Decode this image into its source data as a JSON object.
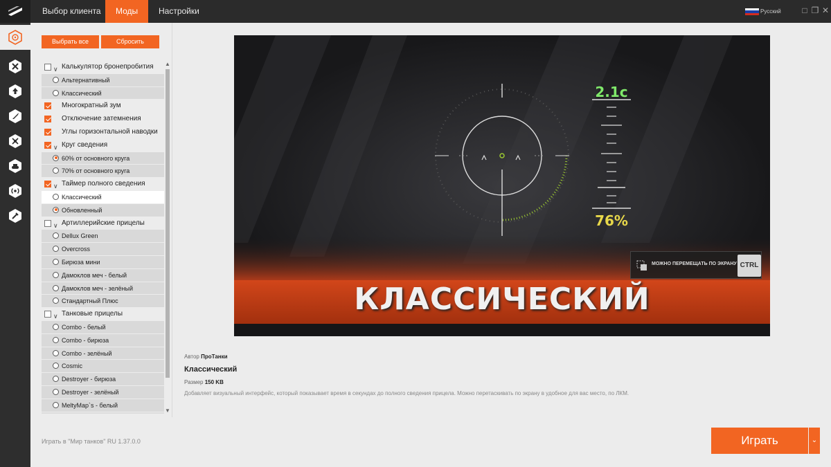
{
  "tabs": [
    {
      "label": "Выбор клиента",
      "active": false
    },
    {
      "label": "Моды",
      "active": true
    },
    {
      "label": "Настройки",
      "active": false
    }
  ],
  "language": "Русский",
  "buttons": {
    "select_all": "Выбрать все",
    "reset": "Сбросить"
  },
  "rail_icons": [
    "crosshair-icon",
    "tools-icon",
    "upload-icon",
    "rocket-icon",
    "repair-icon",
    "tank-icon",
    "radio-icon",
    "wrench-icon"
  ],
  "mods": [
    {
      "type": "group",
      "label": "Калькулятор бронепробития",
      "checked": false,
      "expandable": true
    },
    {
      "type": "option",
      "label": "Альтернативный",
      "selected": false
    },
    {
      "type": "option",
      "label": "Классический",
      "selected": false
    },
    {
      "type": "group",
      "label": "Многократный зум",
      "checked": true,
      "expandable": false
    },
    {
      "type": "group",
      "label": "Отключение затемнения",
      "checked": true,
      "expandable": false
    },
    {
      "type": "group",
      "label": "Углы горизонтальной наводки",
      "checked": true,
      "expandable": false
    },
    {
      "type": "group",
      "label": "Круг сведения",
      "checked": true,
      "expandable": true
    },
    {
      "type": "option",
      "label": "60% от основного круга",
      "selected": true
    },
    {
      "type": "option",
      "label": "70% от основного круга",
      "selected": false
    },
    {
      "type": "group",
      "label": "Таймер полного сведения",
      "checked": true,
      "expandable": true
    },
    {
      "type": "option",
      "label": "Классический",
      "selected": false,
      "highlighted": true
    },
    {
      "type": "option",
      "label": "Обновленный",
      "selected": true
    },
    {
      "type": "group",
      "label": "Артиллерийские прицелы",
      "checked": false,
      "expandable": true
    },
    {
      "type": "option",
      "label": "Dellux Green",
      "selected": false
    },
    {
      "type": "option",
      "label": "Overcross",
      "selected": false
    },
    {
      "type": "option",
      "label": "Бирюза мини",
      "selected": false
    },
    {
      "type": "option",
      "label": "Дамоклов меч - белый",
      "selected": false
    },
    {
      "type": "option",
      "label": "Дамоклов меч - зелёный",
      "selected": false
    },
    {
      "type": "option",
      "label": "Стандартный Плюс",
      "selected": false
    },
    {
      "type": "group",
      "label": "Танковые прицелы",
      "checked": false,
      "expandable": true
    },
    {
      "type": "option",
      "label": "Combo - белый",
      "selected": false
    },
    {
      "type": "option",
      "label": "Combo - бирюза",
      "selected": false
    },
    {
      "type": "option",
      "label": "Combo - зелёный",
      "selected": false
    },
    {
      "type": "option",
      "label": "Cosmic",
      "selected": false
    },
    {
      "type": "option",
      "label": "Destroyer - бирюза",
      "selected": false
    },
    {
      "type": "option",
      "label": "Destroyer - зелёный",
      "selected": false
    },
    {
      "type": "option",
      "label": "MeltyMap`s - белый",
      "selected": false
    }
  ],
  "preview": {
    "timer": "2.1с",
    "percent": "76%",
    "ctrl_hint": "МОЖНО ПЕРЕМЕЩАТЬ ПО ЭКРАНУ",
    "ctrl_key": "CTRL",
    "title": "КЛАССИЧЕСКИЙ"
  },
  "info": {
    "author_label": "Автор",
    "author": "ПроТанки",
    "name": "Классический",
    "size_label": "Размер",
    "size": "150 KB",
    "description": "Добавляет визуальный интерфейс, который показывает время в секундах до полного сведения прицела. Можно перетаскивать по экрану в удобное для вас место, по ЛКМ."
  },
  "version": "Играть в \"Мир танков\" RU 1.37.0.0",
  "play_label": "Играть",
  "colors": {
    "accent": "#f26522",
    "timer_green": "#7fe86a",
    "percent_yellow": "#e8d84a"
  }
}
